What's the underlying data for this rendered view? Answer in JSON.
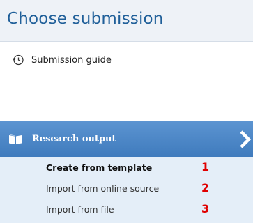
{
  "header": {
    "title": "Choose submission"
  },
  "guide": {
    "label": "Submission guide",
    "icon": "clock-history-icon"
  },
  "research": {
    "label": "Research output",
    "icon": "book-icon"
  },
  "submenu": {
    "items": [
      {
        "label": "Create from template",
        "marker": "1",
        "active": true
      },
      {
        "label": "Import from online source",
        "marker": "2",
        "active": false
      },
      {
        "label": "Import from file",
        "marker": "3",
        "active": false
      }
    ]
  },
  "colors": {
    "title": "#1f5f99",
    "header_bg": "#eef2f7",
    "research_bar": "#4a86c7",
    "submenu_bg": "#e4eef8",
    "marker": "#e00000"
  }
}
